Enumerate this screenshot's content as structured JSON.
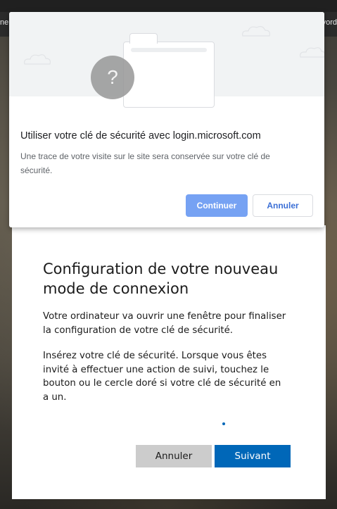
{
  "browser": {
    "edge_text_left": "ne",
    "edge_text_right": "vord"
  },
  "security_dialog": {
    "illustration_glyph": "?",
    "title": "Utiliser votre clé de sécurité avec login.microsoft.com",
    "description": "Une trace de votre visite sur le site sera conservée sur votre clé de sécurité.",
    "continue_label": "Continuer",
    "cancel_label": "Annuler"
  },
  "signin_card": {
    "title": "Configuration de votre nouveau mode de connexion",
    "paragraph1": "Votre ordinateur va ouvrir une fenêtre pour finaliser la configuration de votre clé de sécurité.",
    "paragraph2": "Insérez votre clé de sécurité. Lorsque vous êtes invité à effectuer une action de suivi, touchez le bouton ou le cercle doré si votre clé de sécurité en a un.",
    "cancel_label": "Annuler",
    "next_label": "Suivant"
  },
  "colors": {
    "primary_blue": "#0067b8",
    "dialog_continue": "#76a2f3",
    "cancel_gray": "#cccccc"
  }
}
